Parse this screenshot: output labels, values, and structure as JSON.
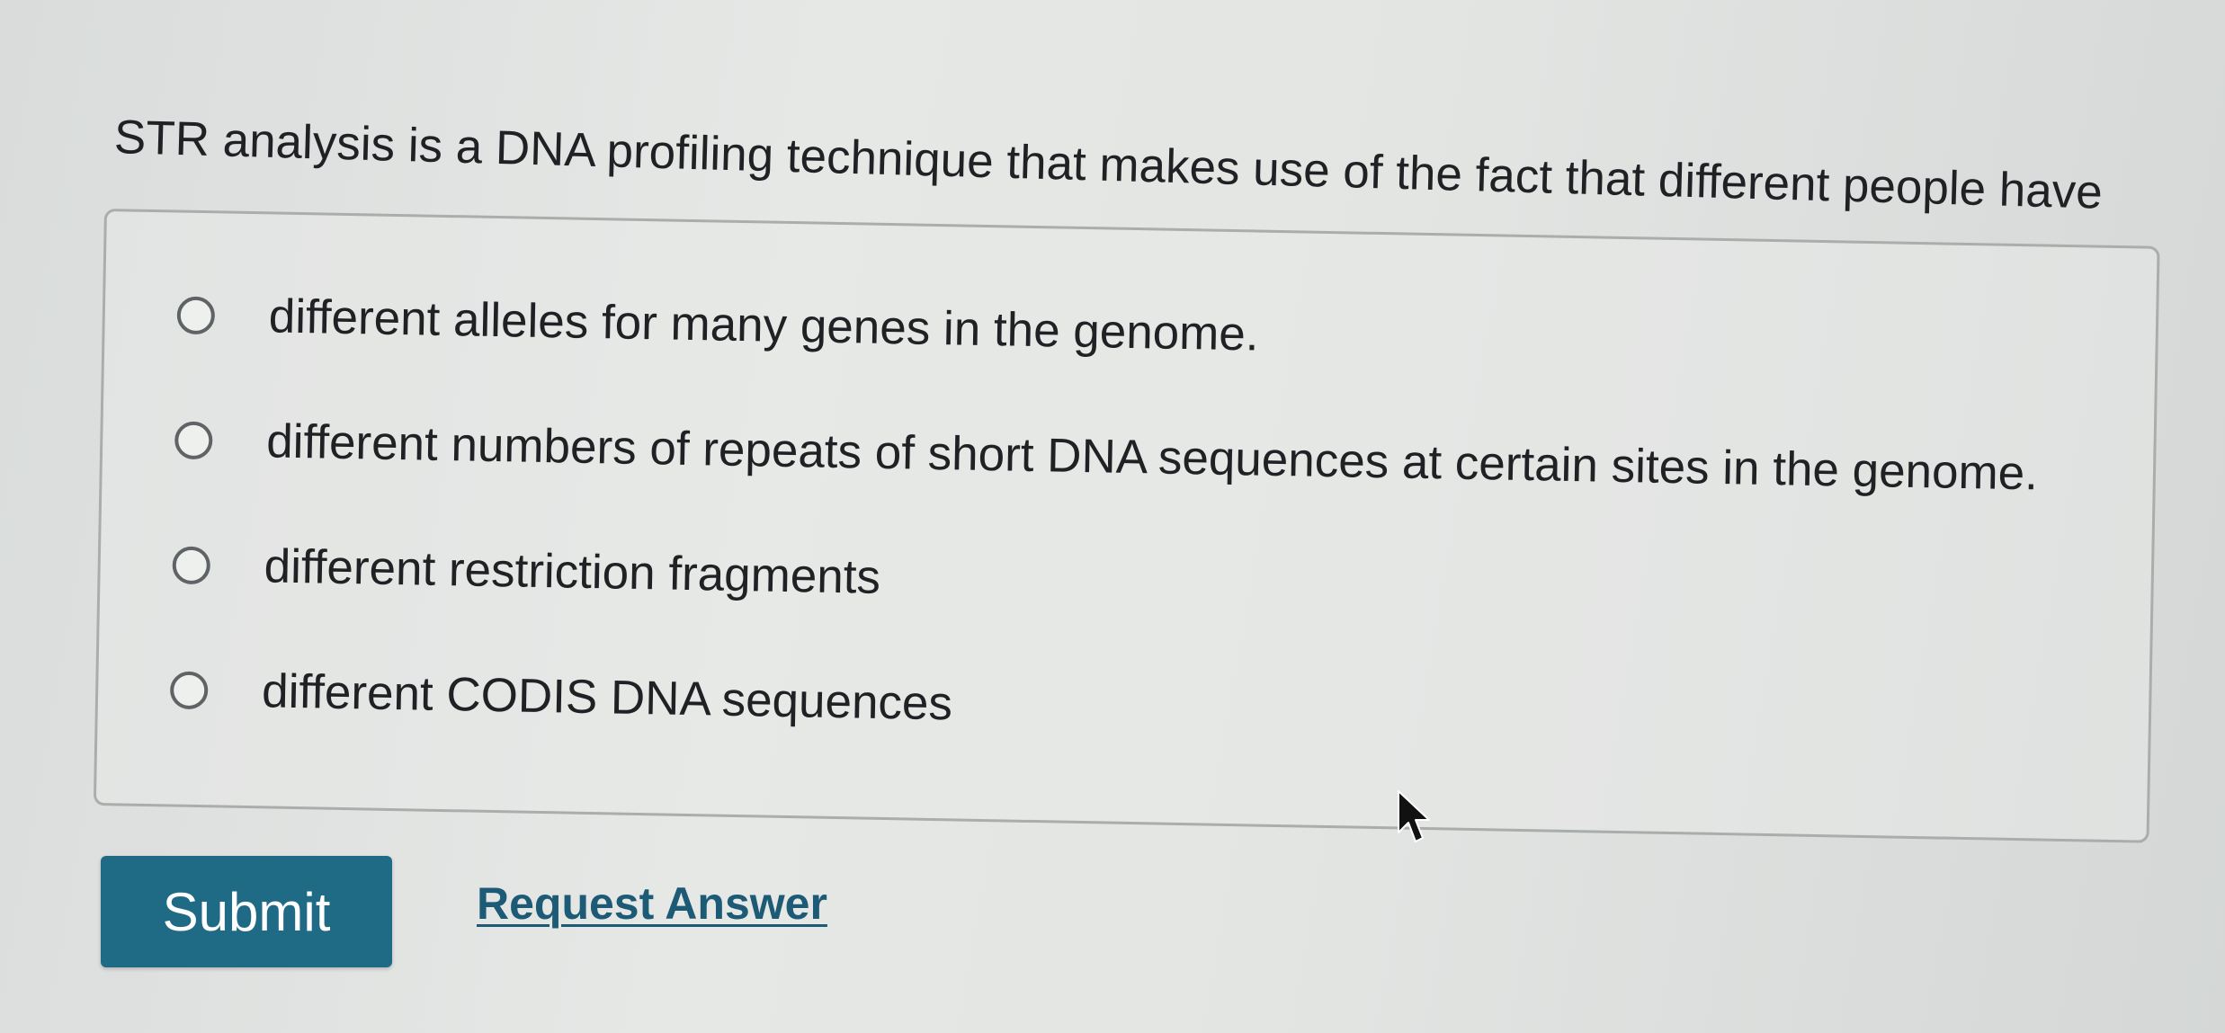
{
  "question": {
    "text": "STR analysis is a DNA profiling technique that makes use of the fact that different people have"
  },
  "options": [
    {
      "label": "different alleles for many genes in the genome.",
      "selected": false
    },
    {
      "label": "different numbers of repeats of short DNA sequences at certain sites in the genome.",
      "selected": false
    },
    {
      "label": "different restriction fragments",
      "selected": false
    },
    {
      "label": "different CODIS DNA sequences",
      "selected": false
    }
  ],
  "actions": {
    "submit_label": "Submit",
    "request_answer_label": "Request Answer"
  },
  "colors": {
    "submit_background": "#1f6a85",
    "link": "#1c5a76"
  },
  "icons": {
    "cursor": "mouse-pointer-icon",
    "radio": "radio-button-unselected"
  }
}
